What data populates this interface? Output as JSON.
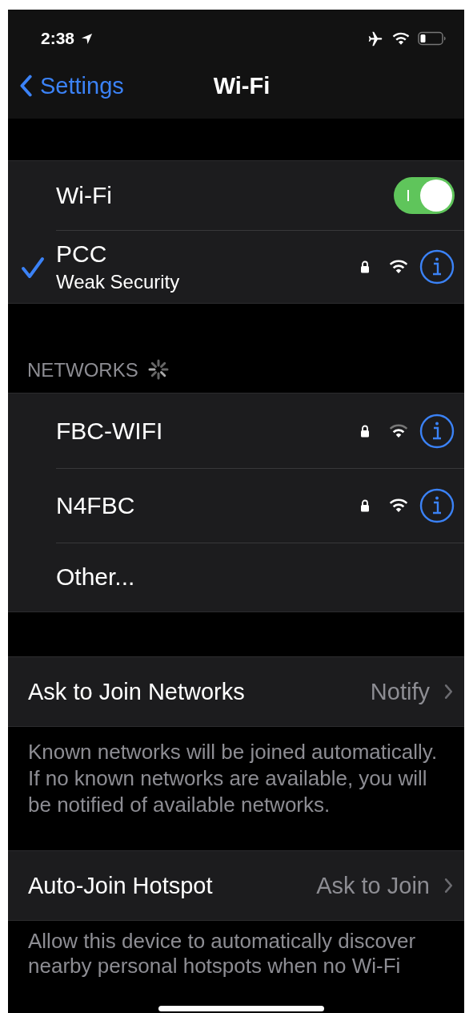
{
  "status_bar": {
    "time": "2:38"
  },
  "nav": {
    "back": "Settings",
    "title": "Wi-Fi"
  },
  "wifi": {
    "label": "Wi-Fi",
    "on": true
  },
  "current": {
    "name": "PCC",
    "detail": "Weak Security",
    "connected": true,
    "secured": true,
    "weak_signal": false
  },
  "networks_header": "NETWORKS",
  "networks": [
    {
      "kind": "network",
      "name": "FBC-WIFI",
      "secured": true,
      "weak_signal": true
    },
    {
      "kind": "network",
      "name": "N4FBC",
      "secured": true,
      "weak_signal": false
    },
    {
      "kind": "other",
      "name": "Other..."
    }
  ],
  "settings": [
    {
      "label": "Ask to Join Networks",
      "value": "Notify",
      "footer": "Known networks will be joined automatically. If no known networks are available, you will be notified of available networks."
    },
    {
      "label": "Auto-Join Hotspot",
      "value": "Ask to Join",
      "footer": "Allow this device to automatically discover nearby personal hotspots when no Wi-Fi"
    }
  ]
}
